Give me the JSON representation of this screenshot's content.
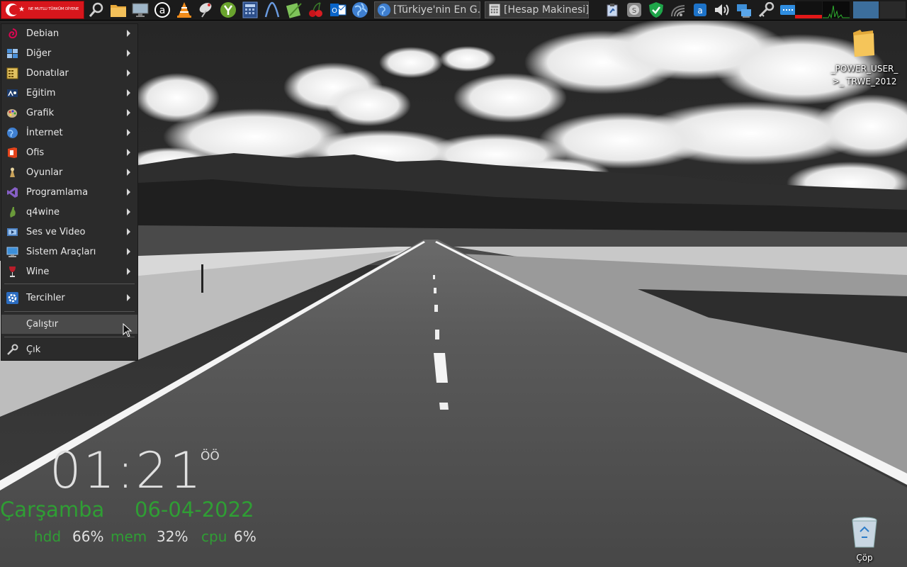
{
  "taskbar": {
    "start_button_text": "NE MUTLU TÜRKÜM DİYENE",
    "tasks": [
      {
        "title": "[Türkiye'nin En G..."
      },
      {
        "title": "[Hesap Makinesi]"
      }
    ]
  },
  "start_menu": {
    "items": [
      {
        "label": "Debian",
        "has_submenu": true,
        "icon": "debian-icon"
      },
      {
        "label": "Diğer",
        "has_submenu": true,
        "icon": "other-icon"
      },
      {
        "label": "Donatılar",
        "has_submenu": true,
        "icon": "accessories-icon"
      },
      {
        "label": "Eğitim",
        "has_submenu": true,
        "icon": "education-icon"
      },
      {
        "label": "Grafik",
        "has_submenu": true,
        "icon": "graphics-icon"
      },
      {
        "label": "İnternet",
        "has_submenu": true,
        "icon": "internet-icon"
      },
      {
        "label": "Ofis",
        "has_submenu": true,
        "icon": "office-icon"
      },
      {
        "label": "Oyunlar",
        "has_submenu": true,
        "icon": "games-icon"
      },
      {
        "label": "Programlama",
        "has_submenu": true,
        "icon": "programming-icon"
      },
      {
        "label": "q4wine",
        "has_submenu": true,
        "icon": "q4wine-icon"
      },
      {
        "label": "Ses ve Video",
        "has_submenu": true,
        "icon": "multimedia-icon"
      },
      {
        "label": "Sistem Araçları",
        "has_submenu": true,
        "icon": "system-tools-icon"
      },
      {
        "label": "Wine",
        "has_submenu": true,
        "icon": "wine-icon"
      },
      {
        "label": "Tercihler",
        "has_submenu": true,
        "icon": "preferences-icon"
      },
      {
        "label": "Çalıştır",
        "has_submenu": false,
        "icon": ""
      },
      {
        "label": "Çık",
        "has_submenu": false,
        "icon": "key-icon"
      }
    ]
  },
  "desktop": {
    "folder_label_line1": "_POWER_USER_",
    "folder_label_line2": ">_ TRWE_2012",
    "trash_label": "Çöp"
  },
  "widget": {
    "time": "01:21",
    "ampm": "ÖÖ",
    "day": "Çarşamba",
    "date": "06-04-2022",
    "hdd_label": "hdd",
    "hdd_value": "66%",
    "mem_label": "mem",
    "mem_value": "32%",
    "cpu_label": "cpu",
    "cpu_value": "6%"
  },
  "colors": {
    "accent_green": "#2f9e34",
    "start_red": "#d8161c",
    "menu_bg": "#2b2b2b"
  }
}
